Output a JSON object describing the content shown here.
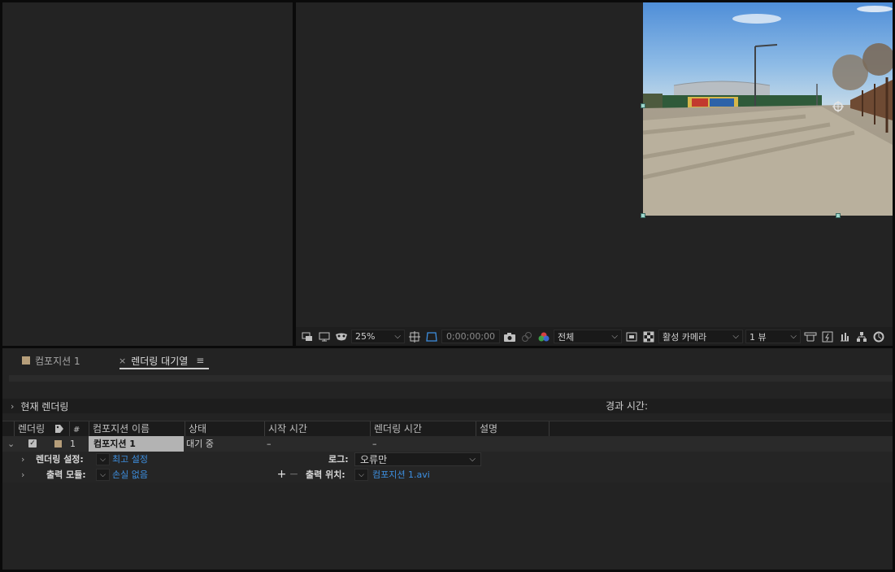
{
  "viewer": {
    "zoom": "25%",
    "timecode": "0;00;00;00",
    "resolution": "전체",
    "camera": "활성 카메라",
    "views": "1 뷰"
  },
  "tabs": [
    {
      "label": "컴포지션 1"
    },
    {
      "label": "렌더링 대기열"
    }
  ],
  "render_queue": {
    "current_render_label": "현재 렌더링",
    "elapsed_label": "경과 시간:",
    "columns": [
      "렌더링",
      "#",
      "컴포지션 이름",
      "상태",
      "시작 시간",
      "렌더링 시간",
      "설명"
    ],
    "rows": [
      {
        "index": "1",
        "comp_name": "컴포지션 1",
        "status": "대기 중",
        "start_time": "–",
        "render_time": "–",
        "render_settings_label": "렌더링 설정:",
        "render_settings_value": "최고 설정",
        "log_label": "로그:",
        "log_value": "오류만",
        "output_module_label": "출력 모듈:",
        "output_module_value": "손실 없음",
        "output_to_label": "출력 위치:",
        "output_to_value": "컴포지션 1.avi"
      }
    ]
  },
  "colors": {
    "panel_bg": "#232323",
    "link_blue": "#3d8fe0",
    "comp_swatch": "#b69e7a",
    "handle": "#9fd6cc"
  }
}
